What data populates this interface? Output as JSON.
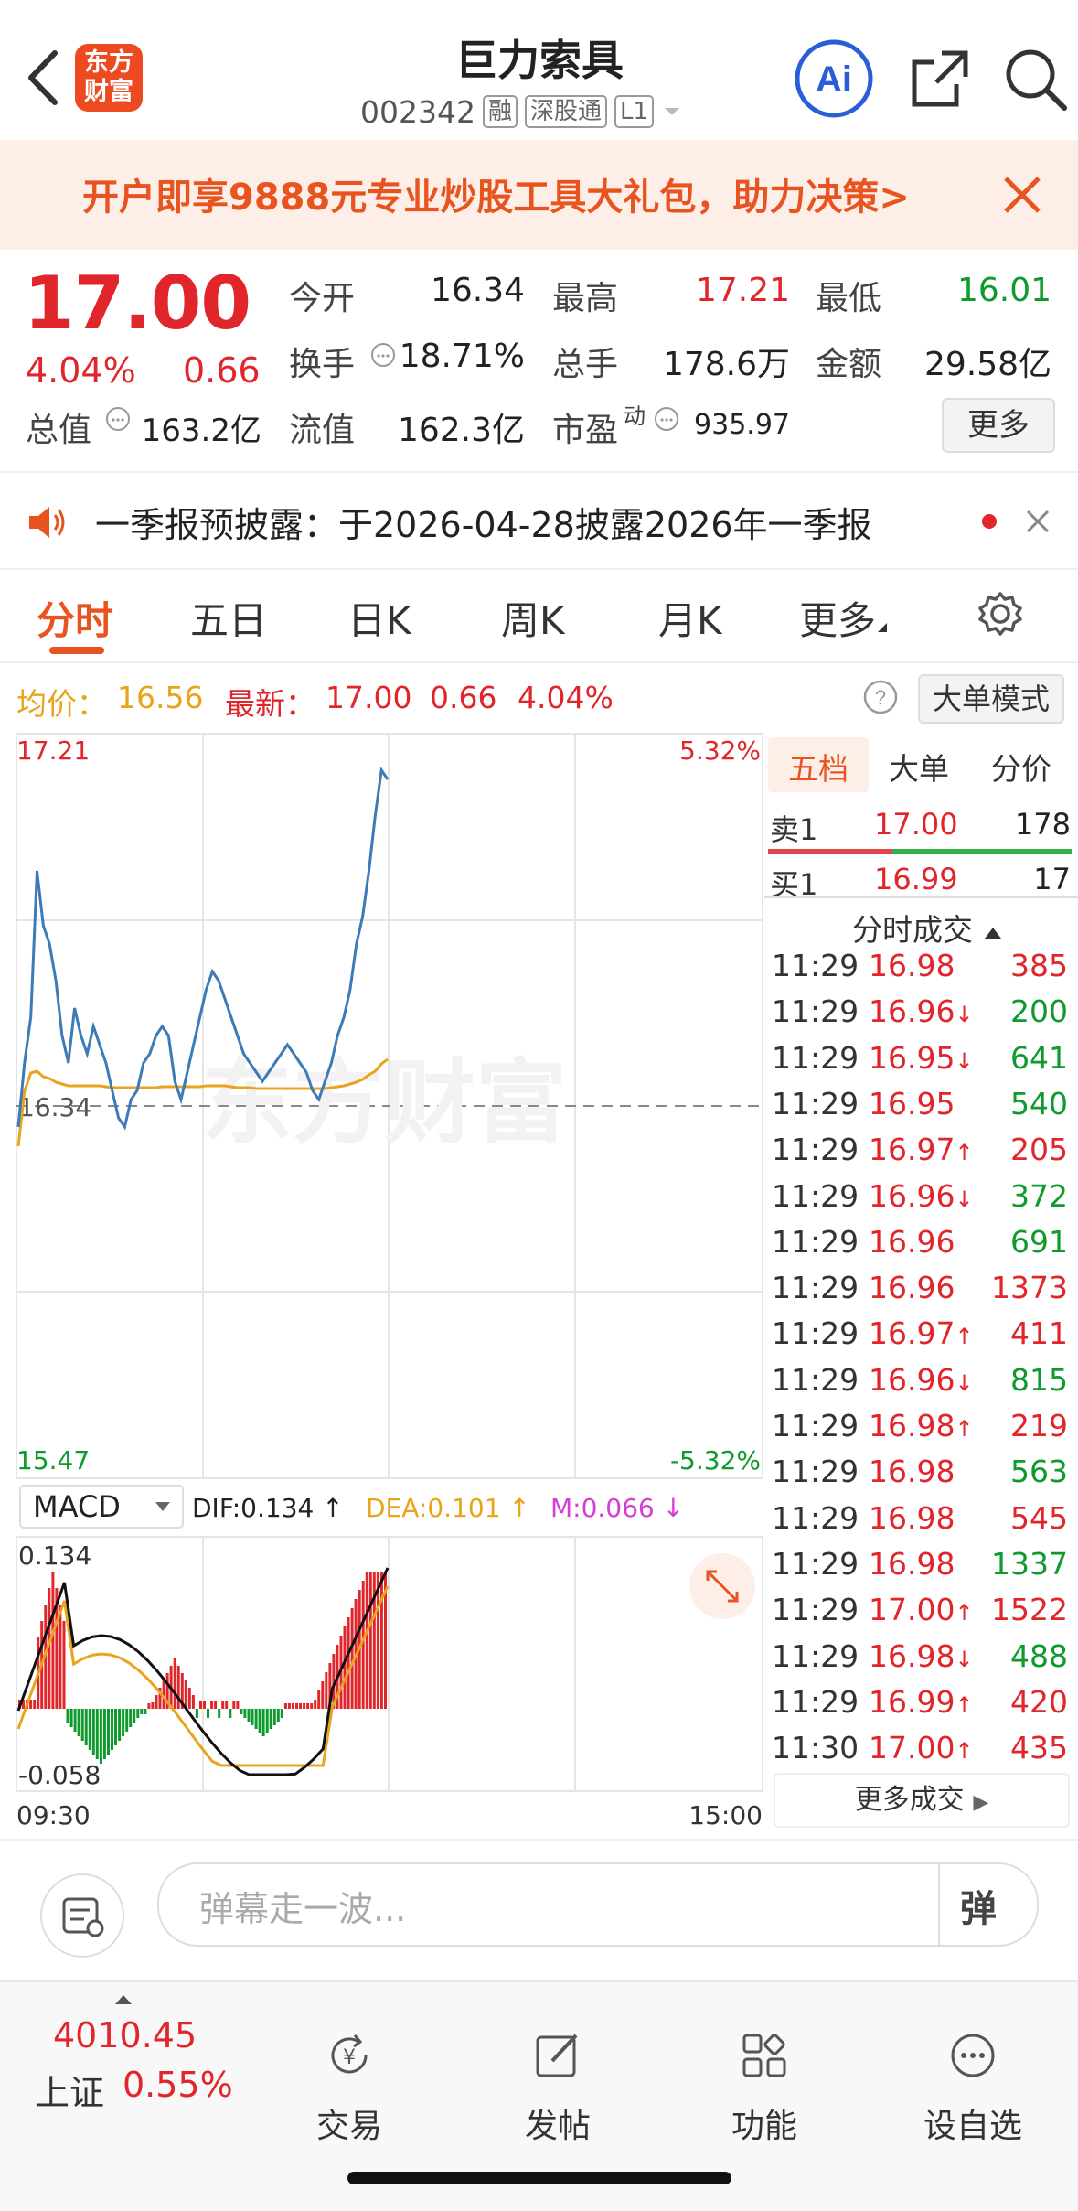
{
  "header": {
    "title": "巨力索具",
    "code": "002342",
    "tags": [
      "融",
      "深股通",
      "L1"
    ],
    "logo": [
      "东方",
      "财富"
    ],
    "ai_label": "Ai"
  },
  "banner": {
    "text": "开户即享9888元专业炒股工具大礼包，助力决策>"
  },
  "quote": {
    "price": "17.00",
    "change_pct": "4.04%",
    "change": "0.66",
    "stats": [
      {
        "label": "今开",
        "value": "16.34",
        "color": "black"
      },
      {
        "label": "最高",
        "value": "17.21",
        "color": "red"
      },
      {
        "label": "最低",
        "value": "16.01",
        "color": "green"
      },
      {
        "label": "换手",
        "value": "18.71%",
        "color": "black"
      },
      {
        "label": "总手",
        "value": "178.6万",
        "color": "black"
      },
      {
        "label": "金额",
        "value": "29.58亿",
        "color": "black"
      },
      {
        "label": "总值",
        "value": "163.2亿",
        "color": "black"
      },
      {
        "label": "流值",
        "value": "162.3亿",
        "color": "black"
      },
      {
        "label": "市盈",
        "value": "935.97",
        "color": "black"
      }
    ],
    "pe_sup": "动",
    "more": "更多"
  },
  "notice": {
    "text": "一季报预披露：于2026-04-28披露2026年一季报"
  },
  "tabs": [
    "分时",
    "五日",
    "日K",
    "周K",
    "月K",
    "更多"
  ],
  "avg": {
    "avg_label": "均价：",
    "avg_value": "16.56",
    "latest_label": "最新：",
    "latest_value": "17.00",
    "latest_change": "0.66",
    "latest_pct": "4.04%",
    "mode_button": "大单模式"
  },
  "chart": {
    "y_top": "17.21",
    "y_bottom": "15.47",
    "pct_top": "5.32%",
    "pct_bottom": "-5.32%",
    "prev_close": "16.34",
    "watermark": "东方财富",
    "time_start": "09:30",
    "time_end": "15:00",
    "macd": {
      "selector": "MACD",
      "dif": "DIF:0.134 ↑",
      "dea": "DEA:0.101 ↑",
      "m": "M:0.066 ↓",
      "top": "0.134",
      "bottom": "-0.058"
    }
  },
  "book": {
    "tabs": [
      "五档",
      "大单",
      "分价"
    ],
    "sell1": {
      "label": "卖1",
      "price": "17.00",
      "vol": "178"
    },
    "buy1": {
      "label": "买1",
      "price": "16.99",
      "vol": "17"
    },
    "trades_title": "分时成交",
    "trades": [
      {
        "time": "11:29",
        "price": "16.98",
        "arrow": "",
        "vol": "385",
        "pc": "red",
        "vc": "red"
      },
      {
        "time": "11:29",
        "price": "16.96",
        "arrow": "↓",
        "vol": "200",
        "pc": "red",
        "vc": "green"
      },
      {
        "time": "11:29",
        "price": "16.95",
        "arrow": "↓",
        "vol": "641",
        "pc": "red",
        "vc": "green"
      },
      {
        "time": "11:29",
        "price": "16.95",
        "arrow": "",
        "vol": "540",
        "pc": "red",
        "vc": "green"
      },
      {
        "time": "11:29",
        "price": "16.97",
        "arrow": "↑",
        "vol": "205",
        "pc": "red",
        "vc": "red"
      },
      {
        "time": "11:29",
        "price": "16.96",
        "arrow": "↓",
        "vol": "372",
        "pc": "red",
        "vc": "green"
      },
      {
        "time": "11:29",
        "price": "16.96",
        "arrow": "",
        "vol": "691",
        "pc": "red",
        "vc": "green"
      },
      {
        "time": "11:29",
        "price": "16.96",
        "arrow": "",
        "vol": "1373",
        "pc": "red",
        "vc": "red"
      },
      {
        "time": "11:29",
        "price": "16.97",
        "arrow": "↑",
        "vol": "411",
        "pc": "red",
        "vc": "red"
      },
      {
        "time": "11:29",
        "price": "16.96",
        "arrow": "↓",
        "vol": "815",
        "pc": "red",
        "vc": "green"
      },
      {
        "time": "11:29",
        "price": "16.98",
        "arrow": "↑",
        "vol": "219",
        "pc": "red",
        "vc": "red"
      },
      {
        "time": "11:29",
        "price": "16.98",
        "arrow": "",
        "vol": "563",
        "pc": "red",
        "vc": "green"
      },
      {
        "time": "11:29",
        "price": "16.98",
        "arrow": "",
        "vol": "545",
        "pc": "red",
        "vc": "red"
      },
      {
        "time": "11:29",
        "price": "16.98",
        "arrow": "",
        "vol": "1337",
        "pc": "red",
        "vc": "green"
      },
      {
        "time": "11:29",
        "price": "17.00",
        "arrow": "↑",
        "vol": "1522",
        "pc": "red",
        "vc": "red"
      },
      {
        "time": "11:29",
        "price": "16.98",
        "arrow": "↓",
        "vol": "488",
        "pc": "red",
        "vc": "green"
      },
      {
        "time": "11:29",
        "price": "16.99",
        "arrow": "↑",
        "vol": "420",
        "pc": "red",
        "vc": "red"
      },
      {
        "time": "11:30",
        "price": "17.00",
        "arrow": "↑",
        "vol": "435",
        "pc": "red",
        "vc": "red"
      }
    ],
    "more_trades": "更多成交"
  },
  "comment": {
    "placeholder": "弹幕走一波...",
    "danmu": "弹"
  },
  "nav": {
    "index_value": "4010.45",
    "index_name": "上证",
    "index_pct": "0.55%",
    "items": [
      "交易",
      "发帖",
      "功能",
      "设自选"
    ]
  },
  "colors": {
    "red": "#e0262b",
    "green": "#0f9a2e",
    "accent": "#e85420",
    "avg": "#e8a51c",
    "price_line": "#3d7ab8"
  }
}
